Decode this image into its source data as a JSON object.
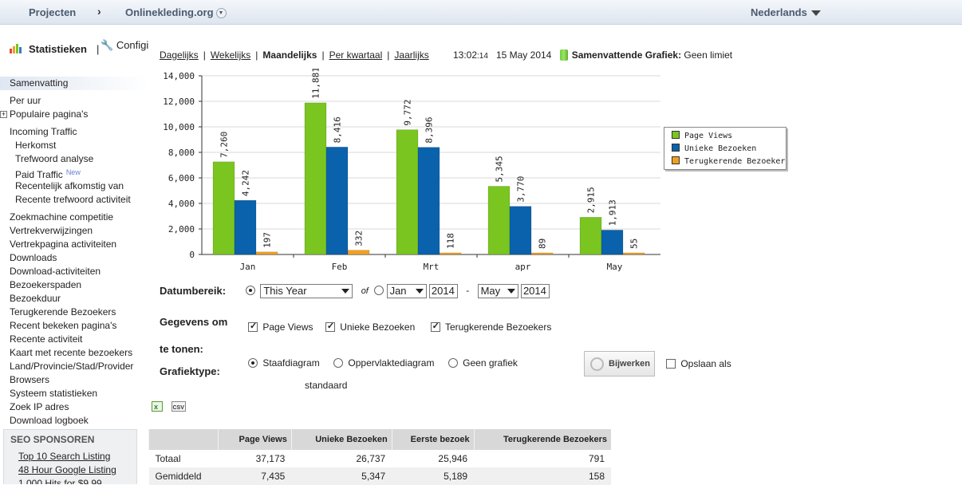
{
  "topbar": {
    "projects": "Projecten",
    "arrow": "›",
    "site": "Onlinekleding.org",
    "language": "Nederlands"
  },
  "sidebar": {
    "stat_tab": "Statistieken",
    "separator": "|",
    "config_tab": "Configi",
    "items": [
      "Samenvatting",
      "Per uur",
      "Populaire pagina's",
      "Incoming Traffic",
      "Herkomst",
      "Trefwoord analyse",
      "Paid Traffic",
      "Recentelijk afkomstig van",
      "Recente trefwoord activiteit",
      "Zoekmachine competitie",
      "Vertrekverwijzingen",
      "Vertrekpagina activiteiten",
      "Downloads",
      "Download-activiteiten",
      "Bezoekerspaden",
      "Bezoekduur",
      "Terugkerende Bezoekers",
      "Recent bekeken pagina's",
      "Recente activiteit",
      "Kaart met recente bezoekers",
      "Land/Provincie/Stad/Provider",
      "Browsers",
      "Systeem statistieken",
      "Zoek IP adres",
      "Download logboek"
    ],
    "new_badge": "New",
    "plus": "+"
  },
  "sponsor": {
    "title": "SEO SPONSOREN",
    "links": [
      "Top 10 Search Listing",
      "48 Hour Google Listing",
      "1,000 Hits for $9.99"
    ]
  },
  "periods": {
    "daily": "Dagelijks",
    "weekly": "Wekelijks",
    "monthly": "Maandelijks",
    "quarterly": "Per kwartaal",
    "yearly": "Jaarlijks",
    "pipe": "|"
  },
  "clock": {
    "time": "13:02",
    "seconds": ":14",
    "date": "15 May 2014",
    "summary_label": "Samenvattende Grafiek:",
    "summary_value": "Geen limiet"
  },
  "chart_data": {
    "type": "bar",
    "categories": [
      "Jan",
      "Feb",
      "Mrt",
      "apr",
      "May"
    ],
    "series": [
      {
        "name": "Page Views",
        "color": "#7ac520",
        "values": [
          7260,
          11881,
          9772,
          5345,
          2915
        ]
      },
      {
        "name": "Unieke Bezoeken",
        "color": "#0a62ad",
        "values": [
          4242,
          8416,
          8396,
          3770,
          1913
        ]
      },
      {
        "name": "Terugkerende Bezoekers",
        "color": "#f0a020",
        "values": [
          197,
          332,
          118,
          89,
          55
        ]
      }
    ],
    "ylim": [
      0,
      14000
    ],
    "yticks": [
      "0",
      "2,000",
      "4,000",
      "6,000",
      "8,000",
      "10,000",
      "12,000",
      "14,000"
    ],
    "data_labels": [
      [
        "7,260",
        "11,881",
        "9,772",
        "5,345",
        "2,915"
      ],
      [
        "4,242",
        "8,416",
        "8,396",
        "3,770",
        "1,913"
      ],
      [
        "197",
        "332",
        "118",
        "89",
        "55"
      ]
    ],
    "grid": true,
    "legend": "right"
  },
  "form": {
    "date_range_label": "Datumbereik:",
    "range_selected": "This Year",
    "of": "of",
    "from_month": "Jan",
    "from_year": "2014",
    "dash": "-",
    "to_month": "May",
    "to_year": "2014",
    "data_label_1": "Gegevens om",
    "data_label_2": "te tonen:",
    "chk_pageviews": "Page Views",
    "chk_unique": "Unieke Bezoeken",
    "chk_returning": "Terugkerende Bezoekers",
    "graph_type_label": "Grafiektype:",
    "opt_bar": "Staafdiagram",
    "opt_area": "Oppervlaktediagram",
    "opt_none": "Geen grafiek",
    "update_button": "Bijwerken",
    "save_as": "Opslaan als",
    "standard": "standaard"
  },
  "export": {
    "excel_icon": "excel-icon",
    "csv": "CSV"
  },
  "table": {
    "headers": [
      "",
      "Page Views",
      "Unieke Bezoeken",
      "Eerste bezoek",
      "Terugkerende Bezoekers"
    ],
    "rows": [
      [
        "Totaal",
        "37,173",
        "26,737",
        "25,946",
        "791"
      ],
      [
        "Gemiddeld",
        "7,435",
        "5,347",
        "5,189",
        "158"
      ]
    ]
  }
}
